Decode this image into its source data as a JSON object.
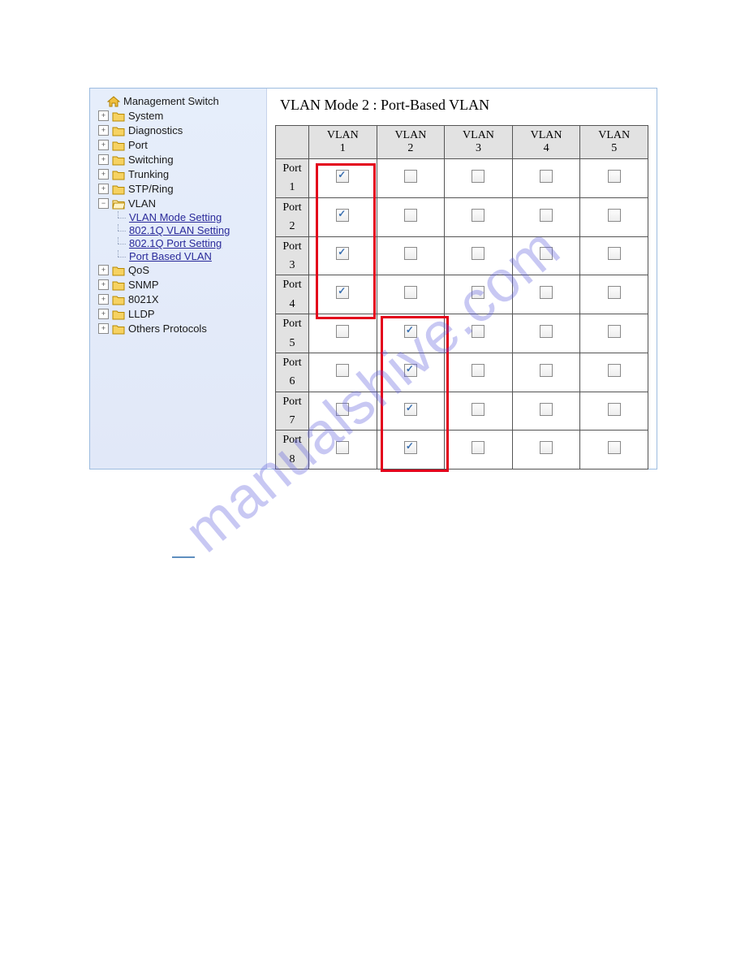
{
  "sidebar": {
    "root": {
      "label": "Management Switch"
    },
    "items": [
      {
        "label": "System",
        "toggle": "+"
      },
      {
        "label": "Diagnostics",
        "toggle": "+"
      },
      {
        "label": "Port",
        "toggle": "+"
      },
      {
        "label": "Switching",
        "toggle": "+"
      },
      {
        "label": "Trunking",
        "toggle": "+"
      },
      {
        "label": "STP/Ring",
        "toggle": "+"
      },
      {
        "label": "VLAN",
        "toggle": "−",
        "children": [
          {
            "label": "VLAN Mode Setting"
          },
          {
            "label": "802.1Q VLAN Setting"
          },
          {
            "label": "802.1Q Port Setting"
          },
          {
            "label": "Port Based VLAN"
          }
        ]
      },
      {
        "label": "QoS",
        "toggle": "+"
      },
      {
        "label": "SNMP",
        "toggle": "+"
      },
      {
        "label": "8021X",
        "toggle": "+"
      },
      {
        "label": "LLDP",
        "toggle": "+"
      },
      {
        "label": "Others Protocols",
        "toggle": "+"
      }
    ]
  },
  "content": {
    "title": "VLAN Mode 2 : Port-Based VLAN",
    "columns": [
      {
        "l1": "VLAN",
        "l2": "1"
      },
      {
        "l1": "VLAN",
        "l2": "2"
      },
      {
        "l1": "VLAN",
        "l2": "3"
      },
      {
        "l1": "VLAN",
        "l2": "4"
      },
      {
        "l1": "VLAN",
        "l2": "5"
      }
    ],
    "rows": [
      {
        "l1": "Port",
        "l2": "1",
        "checked_col": 0
      },
      {
        "l1": "Port",
        "l2": "2",
        "checked_col": 0
      },
      {
        "l1": "Port",
        "l2": "3",
        "checked_col": 0
      },
      {
        "l1": "Port",
        "l2": "4",
        "checked_col": 0
      },
      {
        "l1": "Port",
        "l2": "5",
        "checked_col": 1
      },
      {
        "l1": "Port",
        "l2": "6",
        "checked_col": 1
      },
      {
        "l1": "Port",
        "l2": "7",
        "checked_col": 1
      },
      {
        "l1": "Port",
        "l2": "8",
        "checked_col": 1
      }
    ]
  },
  "watermark": "manualshive.com"
}
